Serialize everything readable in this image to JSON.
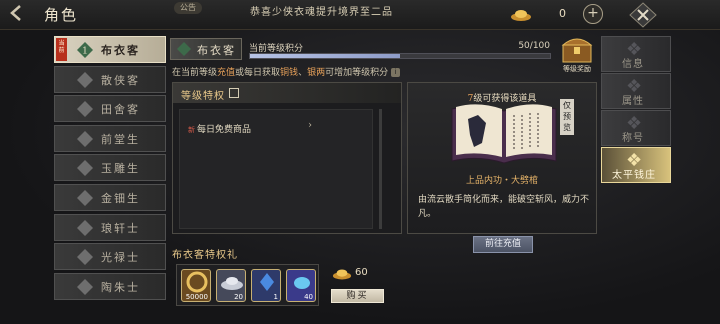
{
  "header": {
    "title": "角色",
    "notice_badge": "公告",
    "notice_text": "恭喜少侠衣魂提升境界至二品",
    "currency_value": "0",
    "add_label": "+"
  },
  "rank_list": {
    "current_tag": "当前",
    "items": [
      {
        "label": "布衣客",
        "active": true
      },
      {
        "label": "散侠客",
        "active": false
      },
      {
        "label": "田舍客",
        "active": false
      },
      {
        "label": "前堂生",
        "active": false
      },
      {
        "label": "玉雕生",
        "active": false
      },
      {
        "label": "金钿生",
        "active": false
      },
      {
        "label": "琅轩士",
        "active": false
      },
      {
        "label": "光禄士",
        "active": false
      },
      {
        "label": "陶朱士",
        "active": false
      }
    ]
  },
  "rank_header": {
    "rank_name": "布衣客",
    "progress_label": "当前等级积分",
    "progress_text": "50/100",
    "progress_fraction": 0.5,
    "hint_pre": "在当前等级",
    "hint_recharge": "充值",
    "hint_mid": "或每日获取",
    "hint_copper": "铜钱",
    "hint_sep": "、",
    "hint_silver": "银两",
    "hint_post": "可增加等级积分",
    "hint_icon": "i",
    "level_reward_label": "等级奖励"
  },
  "privileges": {
    "title": "等级特权",
    "new_tag": "新",
    "row_label": "每日免费商品"
  },
  "book": {
    "title_level": "7",
    "title_rest": "级可获得该道具",
    "preview_tag": "仅预览",
    "name": "上品内功・大劈棺",
    "description": "由流云散手简化而来，能破空斩风，威力不凡。",
    "goto_label": "前往充值"
  },
  "gift": {
    "title": "布衣客特权礼",
    "items": [
      {
        "icon": "coin-ring-icon",
        "count": "50000"
      },
      {
        "icon": "silver-ingot-icon",
        "count": "20"
      },
      {
        "icon": "blue-crystal-icon",
        "count": "1"
      },
      {
        "icon": "blue-gem-icon",
        "count": "40"
      }
    ],
    "price": "60",
    "buy_label": "购买"
  },
  "tabs": [
    {
      "label": "信息",
      "active": false
    },
    {
      "label": "属性",
      "active": false
    },
    {
      "label": "称号",
      "active": false
    },
    {
      "label": "太平钱庄",
      "active": true
    }
  ],
  "colors": {
    "accent_gold": "#e8c88a",
    "highlight_orange": "#e8a25a",
    "active_tab": "#d8c27c"
  }
}
